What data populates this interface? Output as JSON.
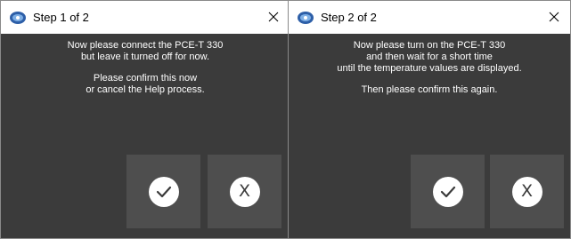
{
  "dialogs": [
    {
      "title": "Step 1 of 2",
      "message": [
        "Now please connect the PCE-T 330",
        "but leave it turned off for now.",
        "Please confirm this now",
        "or cancel the Help process."
      ],
      "cancel_label": "X"
    },
    {
      "title": "Step 2 of 2",
      "message": [
        "Now please turn on the PCE-T 330",
        "and then wait for a short time",
        "until the temperature values are displayed.",
        "Then please confirm this again."
      ],
      "cancel_label": "X"
    }
  ],
  "icons": {
    "app": "app-logo-icon",
    "close": "close-icon",
    "confirm": "checkmark-icon",
    "cancel": "x-icon"
  },
  "colors": {
    "dialog_bg": "#3b3b3b",
    "button_bg": "#4e4e4e",
    "text": "#ffffff",
    "titlebar_bg": "#ffffff"
  }
}
